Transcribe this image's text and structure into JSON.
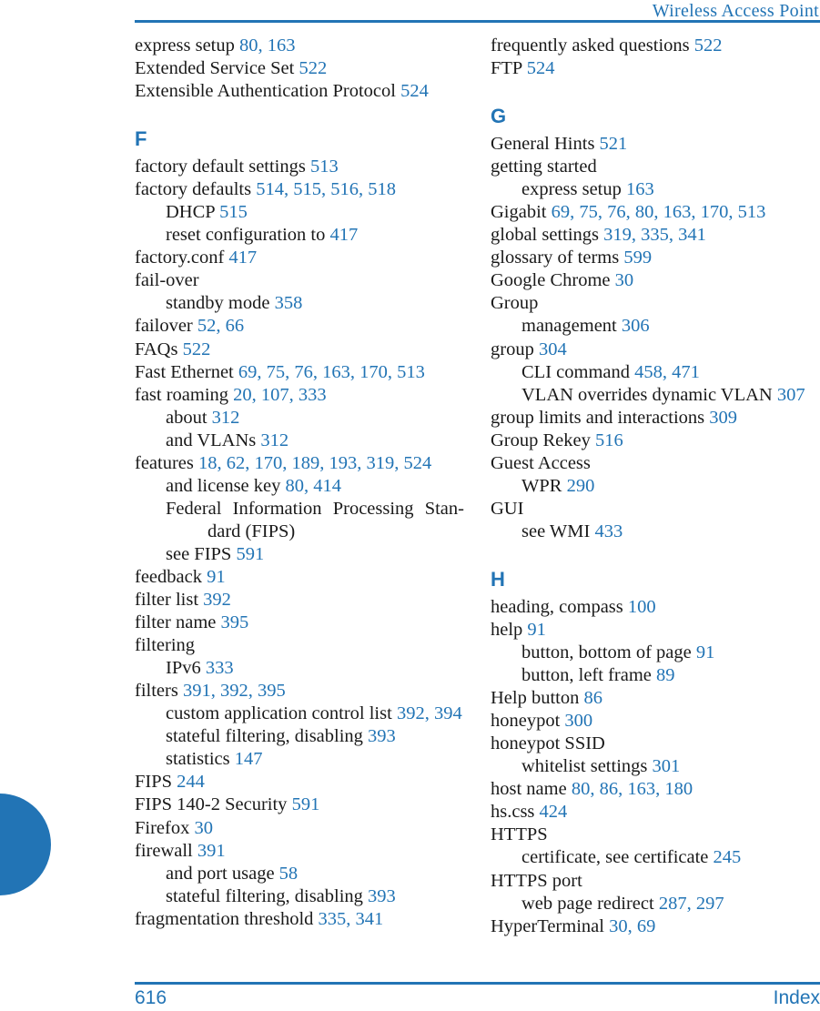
{
  "header": {
    "title": "Wireless Access Point"
  },
  "footer": {
    "page_number": "616",
    "label": "Index"
  },
  "colors": {
    "accent": "#2274b5",
    "body_text": "#1a1a1a"
  },
  "columns": [
    {
      "name": "left-column",
      "blocks": [
        {
          "type": "entry",
          "level": 1,
          "text": "express setup ",
          "pages": "80, 163"
        },
        {
          "type": "entry",
          "level": 1,
          "text": "Extended Service Set ",
          "pages": "522"
        },
        {
          "type": "entry",
          "level": 1,
          "text": "Extensible Authentication Protocol ",
          "pages": "524"
        },
        {
          "type": "letter",
          "text": "F"
        },
        {
          "type": "entry",
          "level": 1,
          "text": "factory default settings ",
          "pages": "513"
        },
        {
          "type": "entry",
          "level": 1,
          "text": "factory defaults ",
          "pages": "514, 515, 516, 518"
        },
        {
          "type": "entry",
          "level": 2,
          "text": "DHCP ",
          "pages": "515"
        },
        {
          "type": "entry",
          "level": 2,
          "text": "reset configuration to ",
          "pages": "417"
        },
        {
          "type": "entry",
          "level": 1,
          "text": "factory.conf ",
          "pages": "417"
        },
        {
          "type": "entry",
          "level": 1,
          "text": "fail-over",
          "pages": ""
        },
        {
          "type": "entry",
          "level": 2,
          "text": "standby mode ",
          "pages": "358"
        },
        {
          "type": "entry",
          "level": 1,
          "text": "failover ",
          "pages": "52, 66"
        },
        {
          "type": "entry",
          "level": 1,
          "text": "FAQs ",
          "pages": "522"
        },
        {
          "type": "entry",
          "level": 1,
          "text": "Fast Ethernet ",
          "pages": "69, 75, 76, 163, 170, 513"
        },
        {
          "type": "entry",
          "level": 1,
          "text": "fast roaming ",
          "pages": "20, 107, 333"
        },
        {
          "type": "entry",
          "level": 2,
          "text": "about ",
          "pages": "312"
        },
        {
          "type": "entry",
          "level": 2,
          "text": "and VLANs ",
          "pages": "312"
        },
        {
          "type": "entry",
          "level": 1,
          "text": "features ",
          "pages": "18, 62, 170, 189, 193, 319, 524"
        },
        {
          "type": "entry",
          "level": 2,
          "text": "and license key ",
          "pages": "80, 414"
        },
        {
          "type": "entry-justified",
          "level": 1,
          "text": "Federal Information Processing Stan­dard (FIPS)",
          "pages": ""
        },
        {
          "type": "entry",
          "level": 2,
          "text": "see FIPS ",
          "pages": "591"
        },
        {
          "type": "entry",
          "level": 1,
          "text": "feedback ",
          "pages": "91"
        },
        {
          "type": "entry",
          "level": 1,
          "text": "filter list ",
          "pages": "392"
        },
        {
          "type": "entry",
          "level": 1,
          "text": "filter name ",
          "pages": "395"
        },
        {
          "type": "entry",
          "level": 1,
          "text": "filtering",
          "pages": ""
        },
        {
          "type": "entry",
          "level": 2,
          "text": "IPv6 ",
          "pages": "333"
        },
        {
          "type": "entry",
          "level": 1,
          "text": "filters ",
          "pages": "391, 392, 395"
        },
        {
          "type": "entry-justified-deep",
          "level": 2,
          "text": "custom application control list ",
          "pages": "392, 394"
        },
        {
          "type": "entry",
          "level": 2,
          "text": "stateful filtering, disabling ",
          "pages": "393"
        },
        {
          "type": "entry",
          "level": 2,
          "text": "statistics ",
          "pages": "147"
        },
        {
          "type": "entry",
          "level": 1,
          "text": "FIPS ",
          "pages": "244"
        },
        {
          "type": "entry",
          "level": 1,
          "text": "FIPS 140-2 Security ",
          "pages": "591"
        },
        {
          "type": "entry",
          "level": 1,
          "text": "Firefox ",
          "pages": "30"
        },
        {
          "type": "entry",
          "level": 1,
          "text": "firewall ",
          "pages": "391"
        },
        {
          "type": "entry",
          "level": 2,
          "text": "and port usage ",
          "pages": "58"
        },
        {
          "type": "entry",
          "level": 2,
          "text": "stateful filtering, disabling ",
          "pages": "393"
        },
        {
          "type": "entry",
          "level": 1,
          "text": "fragmentation threshold ",
          "pages": "335, 341"
        }
      ]
    },
    {
      "name": "right-column",
      "blocks": [
        {
          "type": "entry",
          "level": 1,
          "text": "frequently asked questions ",
          "pages": "522"
        },
        {
          "type": "entry",
          "level": 1,
          "text": "FTP ",
          "pages": "524"
        },
        {
          "type": "letter",
          "text": "G"
        },
        {
          "type": "entry",
          "level": 1,
          "text": "General Hints ",
          "pages": "521"
        },
        {
          "type": "entry",
          "level": 1,
          "text": "getting started",
          "pages": ""
        },
        {
          "type": "entry",
          "level": 2,
          "text": "express setup ",
          "pages": "163"
        },
        {
          "type": "entry",
          "level": 1,
          "text": "Gigabit ",
          "pages": "69, 75, 76, 80, 163, 170, 513"
        },
        {
          "type": "entry",
          "level": 1,
          "text": "global settings ",
          "pages": "319, 335, 341"
        },
        {
          "type": "entry",
          "level": 1,
          "text": "glossary of terms ",
          "pages": "599"
        },
        {
          "type": "entry",
          "level": 1,
          "text": "Google Chrome ",
          "pages": "30"
        },
        {
          "type": "entry",
          "level": 1,
          "text": "Group",
          "pages": ""
        },
        {
          "type": "entry",
          "level": 2,
          "text": "management ",
          "pages": "306"
        },
        {
          "type": "entry",
          "level": 1,
          "text": "group ",
          "pages": "304"
        },
        {
          "type": "entry",
          "level": 2,
          "text": "CLI command ",
          "pages": "458, 471"
        },
        {
          "type": "entry-justified-deep2",
          "level": 2,
          "text": "VLAN overrides dynamic VLAN ",
          "pages": "307"
        },
        {
          "type": "entry",
          "level": 1,
          "text": "group limits and interactions ",
          "pages": "309"
        },
        {
          "type": "entry",
          "level": 1,
          "text": "Group Rekey ",
          "pages": "516"
        },
        {
          "type": "entry",
          "level": 1,
          "text": "Guest Access",
          "pages": ""
        },
        {
          "type": "entry",
          "level": 2,
          "text": "WPR ",
          "pages": "290"
        },
        {
          "type": "entry",
          "level": 1,
          "text": "GUI",
          "pages": ""
        },
        {
          "type": "entry",
          "level": 2,
          "text": "see WMI ",
          "pages": "433"
        },
        {
          "type": "letter",
          "text": "H"
        },
        {
          "type": "entry",
          "level": 1,
          "text": "heading, compass ",
          "pages": "100"
        },
        {
          "type": "entry",
          "level": 1,
          "text": "help ",
          "pages": "91"
        },
        {
          "type": "entry",
          "level": 2,
          "text": "button, bottom of page ",
          "pages": "91"
        },
        {
          "type": "entry",
          "level": 2,
          "text": "button, left frame ",
          "pages": "89"
        },
        {
          "type": "entry",
          "level": 1,
          "text": "Help button ",
          "pages": "86"
        },
        {
          "type": "entry",
          "level": 1,
          "text": "honeypot ",
          "pages": "300"
        },
        {
          "type": "entry",
          "level": 1,
          "text": "honeypot SSID",
          "pages": ""
        },
        {
          "type": "entry",
          "level": 2,
          "text": "whitelist settings ",
          "pages": "301"
        },
        {
          "type": "entry",
          "level": 1,
          "text": "host name ",
          "pages": "80, 86, 163, 180"
        },
        {
          "type": "entry",
          "level": 1,
          "text": "hs.css ",
          "pages": "424"
        },
        {
          "type": "entry",
          "level": 1,
          "text": "HTTPS",
          "pages": ""
        },
        {
          "type": "entry",
          "level": 2,
          "text": "certificate, see certificate ",
          "pages": "245"
        },
        {
          "type": "entry",
          "level": 1,
          "text": "HTTPS port",
          "pages": ""
        },
        {
          "type": "entry",
          "level": 2,
          "text": "web page redirect ",
          "pages": "287, 297"
        },
        {
          "type": "entry",
          "level": 1,
          "text": "HyperTerminal ",
          "pages": "30, 69"
        }
      ]
    }
  ]
}
